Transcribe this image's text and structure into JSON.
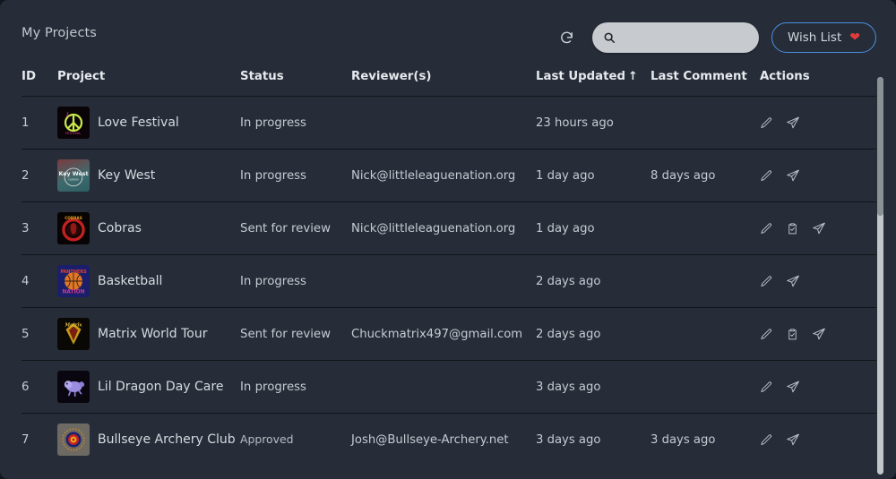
{
  "header": {
    "title": "My Projects",
    "refresh_icon": "refresh-icon",
    "search": {
      "value": "",
      "placeholder": "",
      "icon": "search-icon"
    },
    "wish_list": {
      "label": "Wish List",
      "icon": "heart-icon",
      "border_color": "#4a90e2",
      "heart_color": "#e23b3b"
    }
  },
  "table": {
    "columns": [
      {
        "key": "id",
        "label": "ID"
      },
      {
        "key": "project",
        "label": "Project"
      },
      {
        "key": "status",
        "label": "Status"
      },
      {
        "key": "reviewers",
        "label": "Reviewer(s)"
      },
      {
        "key": "last_updated",
        "label": "Last Updated",
        "sort": "↑"
      },
      {
        "key": "last_comment",
        "label": "Last Comment"
      },
      {
        "key": "actions",
        "label": "Actions"
      }
    ],
    "rows": [
      {
        "id": "1",
        "project": "Love Festival",
        "status": "In progress",
        "reviewers": "",
        "last_updated": "23 hours ago",
        "last_comment": "",
        "actions": [
          "edit-icon",
          "send-icon"
        ],
        "thumb": "love-festival-thumb"
      },
      {
        "id": "2",
        "project": "Key West",
        "status": "In progress",
        "reviewers": "Nick@littleleaguenation.org",
        "last_updated": "1 day ago",
        "last_comment": "8 days ago",
        "actions": [
          "edit-icon",
          "send-icon"
        ],
        "thumb": "key-west-thumb"
      },
      {
        "id": "3",
        "project": "Cobras",
        "status": "Sent for review",
        "reviewers": "Nick@littleleaguenation.org",
        "last_updated": "1 day ago",
        "last_comment": "",
        "actions": [
          "edit-icon",
          "review-icon",
          "send-icon"
        ],
        "thumb": "cobras-thumb"
      },
      {
        "id": "4",
        "project": "Basketball",
        "status": "In progress",
        "reviewers": "",
        "last_updated": "2 days ago",
        "last_comment": "",
        "actions": [
          "edit-icon",
          "send-icon"
        ],
        "thumb": "basketball-thumb"
      },
      {
        "id": "5",
        "project": "Matrix World Tour",
        "status": "Sent for review",
        "reviewers": "Chuckmatrix497@gmail.com",
        "last_updated": "2 days ago",
        "last_comment": "",
        "actions": [
          "edit-icon",
          "review-icon",
          "send-icon"
        ],
        "thumb": "matrix-thumb"
      },
      {
        "id": "6",
        "project": "Lil Dragon Day Care",
        "status": "In progress",
        "reviewers": "",
        "last_updated": "3 days ago",
        "last_comment": "",
        "actions": [
          "edit-icon",
          "send-icon"
        ],
        "thumb": "lil-dragon-thumb"
      },
      {
        "id": "7",
        "project": "Bullseye Archery Club",
        "status": "Approved",
        "reviewers": "Josh@Bullseye-Archery.net",
        "last_updated": "3 days ago",
        "last_comment": "3 days ago",
        "actions": [
          "edit-icon",
          "send-icon"
        ],
        "thumb": "bullseye-thumb"
      }
    ]
  },
  "scrollbar": {
    "name": "vertical-scrollbar"
  },
  "thumb_art": {
    "love-festival-thumb": "peace sign",
    "key-west-thumb": "Key West",
    "cobras-thumb": "COBRAS",
    "basketball-thumb": "PANTHERS NATION",
    "matrix-thumb": "Matrix",
    "lil-dragon-thumb": "dragon",
    "bullseye-thumb": "target"
  },
  "colors": {
    "page_bg": "#262d38",
    "row_divider": "#11151a",
    "accent_blue": "#4a90e2",
    "heart_red": "#e23b3b"
  }
}
